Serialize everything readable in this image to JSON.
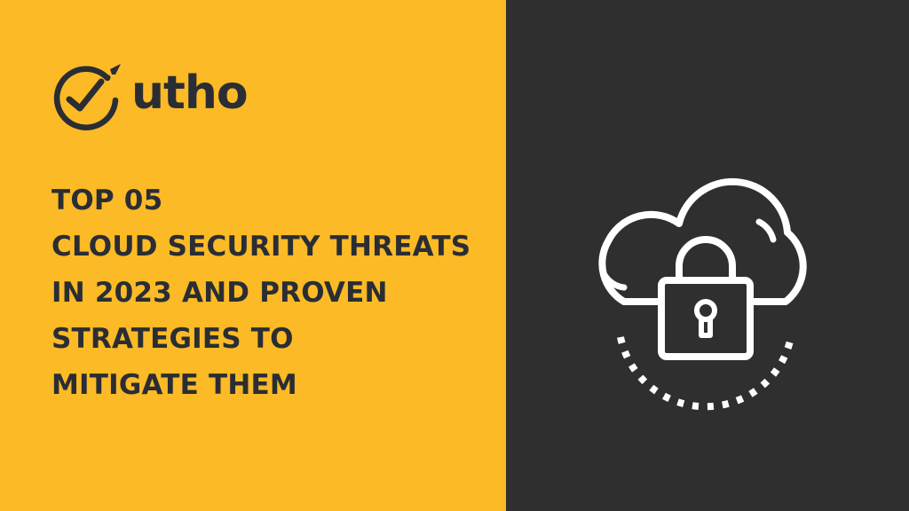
{
  "brand": {
    "name": "utho",
    "logo_icon": "check-circle-rocket-icon"
  },
  "headline": {
    "lines": [
      "TOP 05",
      "CLOUD SECURITY THREATS",
      "IN 2023 AND PROVEN",
      "STRATEGIES TO",
      "MITIGATE THEM"
    ]
  },
  "illustration": {
    "icon": "cloud-lock-icon"
  },
  "colors": {
    "accent_yellow": "#FBBA26",
    "dark_panel": "#2F2F2F",
    "text_dark": "#2A2D33",
    "icon_white": "#FFFFFF"
  }
}
